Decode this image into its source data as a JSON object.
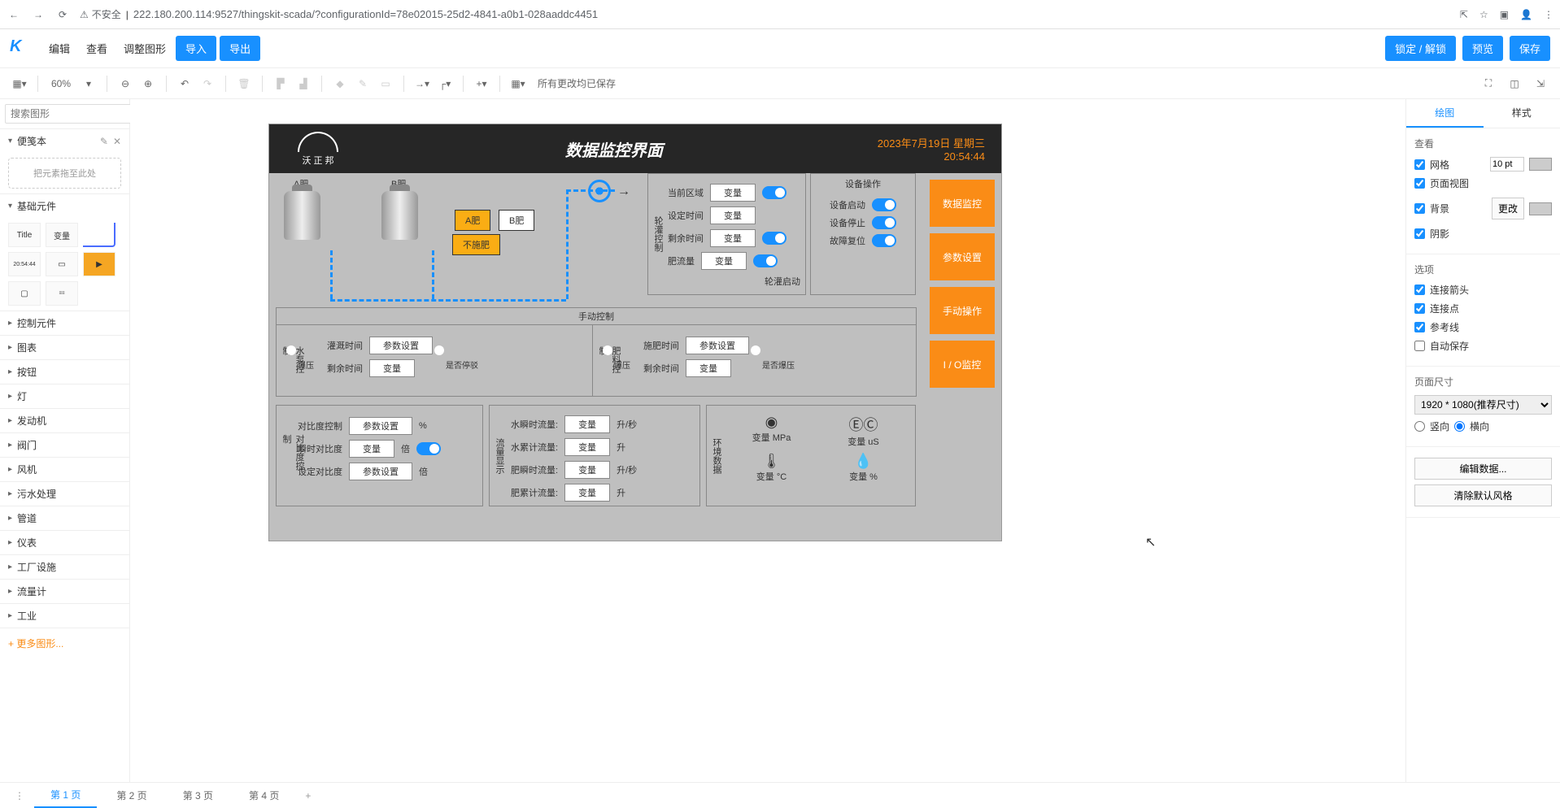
{
  "browser": {
    "warn": "不安全",
    "url": "222.180.200.114:9527/thingskit-scada/?configurationId=78e02015-25d2-4841-a0b1-028aaddc4451"
  },
  "menubar": {
    "edit": "编辑",
    "view": "查看",
    "adjust": "调整图形",
    "import": "导入",
    "export": "导出",
    "lock": "锁定 / 解锁",
    "preview": "预览",
    "save": "保存"
  },
  "toolbar": {
    "zoom": "60%",
    "status": "所有更改均已保存"
  },
  "left": {
    "search_ph": "搜索图形",
    "scratch": "便笺本",
    "drop_hint": "把元素拖至此处",
    "basic": "基础元件",
    "t_title": "Title",
    "t_var": "变量",
    "t_time": "20:54:44",
    "cats": [
      "控制元件",
      "图表",
      "按钮",
      "灯",
      "发动机",
      "阀门",
      "风机",
      "污水处理",
      "管道",
      "仪表",
      "工厂设施",
      "流量计",
      "工业"
    ],
    "more": "+ 更多图形..."
  },
  "dash": {
    "brand": "沃 正 邦",
    "title": "数据监控界面",
    "date": "2023年7月19日 星期三",
    "time": "20:54:44",
    "tank_a": "A肥",
    "tank_b": "B肥",
    "btn_a": "A肥",
    "btn_b": "B肥",
    "btn_none": "不施肥",
    "irr_title": "轮灌控制",
    "irr_rows": {
      "area": "当前区域",
      "set": "设定时间",
      "rem": "剩余时间",
      "flow": "肥流量",
      "start": "轮灌启动"
    },
    "var": "变量",
    "ops_title": "设备操作",
    "ops": {
      "start": "设备启动",
      "stop": "设备停止",
      "reset": "故障复位"
    },
    "side": [
      "数据监控",
      "参数设置",
      "手动操作",
      "I / O监控"
    ],
    "manual": "手动控制",
    "pump_title": "水泵控制",
    "pump": {
      "fault": "爆压",
      "irr": "灌溉时间",
      "rem": "剩余时间",
      "param": "参数设置",
      "stop": "是否停驳"
    },
    "fert_title": "肥料控制",
    "fert": {
      "fault": "爆压",
      "time": "施肥时间",
      "rem": "剩余时间",
      "param": "参数设置",
      "pump": "是否爆压"
    },
    "ratio_title": "对比度控制",
    "ratio": {
      "ctrl": "对比度控制",
      "inst": "瞬时对比度",
      "set": "设定对比度",
      "param": "参数设置",
      "pct": "%",
      "x": "倍"
    },
    "flow_title": "流量显示",
    "flow": {
      "wi": "水瞬时流量:",
      "wt": "水累计流量:",
      "fi": "肥瞬时流量:",
      "ft": "肥累计流量:",
      "lps": "升/秒",
      "l": "升"
    },
    "env_title": "环境数据",
    "env": {
      "mpa": "MPa",
      "us": "uS",
      "c": "°C",
      "pct": "%"
    }
  },
  "right": {
    "tab_draw": "绘图",
    "tab_style": "样式",
    "view": "查看",
    "grid": "网格",
    "page": "页面视图",
    "bg": "背景",
    "shadow": "阴影",
    "change": "更改",
    "pt": "10 pt",
    "opts": "选项",
    "arrow": "连接箭头",
    "conn": "连接点",
    "guide": "参考线",
    "auto": "自动保存",
    "psize": "页面尺寸",
    "psize_val": "1920 * 1080(推荐尺寸)",
    "vert": "竖向",
    "horiz": "横向",
    "edit_data": "编辑数据...",
    "clear": "清除默认风格"
  },
  "pages": {
    "p1": "第 1 页",
    "p2": "第 2 页",
    "p3": "第 3 页",
    "p4": "第 4 页"
  }
}
